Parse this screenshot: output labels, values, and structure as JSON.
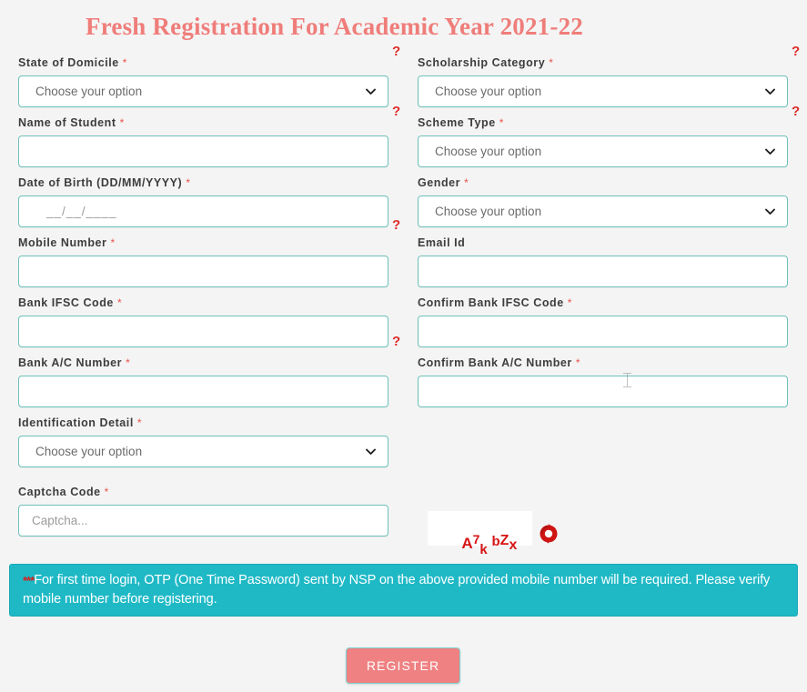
{
  "page": {
    "title": "Fresh Registration For Academic Year 2021-22",
    "background_color": "#f4f4f4",
    "title_color": "#ef7d7a",
    "accent_border_color": "#6cc1b9",
    "required_marker": "*",
    "help_marker": "?"
  },
  "form": {
    "left_column": [
      {
        "label": "State of Domicile",
        "required": true,
        "type": "select",
        "value": "Choose your option",
        "has_help": true
      },
      {
        "label": "Name of Student",
        "required": true,
        "type": "text",
        "value": "",
        "placeholder": "",
        "has_help": false
      },
      {
        "label": "Date of Birth (DD/MM/YYYY)",
        "required": true,
        "type": "text",
        "value": "",
        "placeholder": "__/__/____",
        "has_help": true
      },
      {
        "label": "Mobile Number",
        "required": true,
        "type": "text",
        "value": "",
        "placeholder": "",
        "has_help": false
      },
      {
        "label": "Bank IFSC Code",
        "required": true,
        "type": "text",
        "value": "",
        "placeholder": "",
        "has_help": true
      },
      {
        "label": "Bank A/C Number",
        "required": true,
        "type": "text",
        "value": "",
        "placeholder": "",
        "has_help": false
      },
      {
        "label": "Identification Detail",
        "required": true,
        "type": "select",
        "value": "Choose your option",
        "has_help": false
      }
    ],
    "right_column": [
      {
        "label": "Scholarship Category",
        "required": true,
        "type": "select",
        "value": "Choose your option",
        "has_help": true
      },
      {
        "label": "Scheme Type",
        "required": true,
        "type": "select",
        "value": "Choose your option",
        "has_help": false
      },
      {
        "label": "Gender",
        "required": true,
        "type": "select",
        "value": "Choose your option",
        "has_help": false
      },
      {
        "label": "Email Id",
        "required": false,
        "type": "text",
        "value": "",
        "placeholder": "",
        "has_help": false
      },
      {
        "label": "Confirm Bank IFSC Code",
        "required": true,
        "type": "text",
        "value": "",
        "placeholder": "",
        "has_help": false
      },
      {
        "label": "Confirm Bank A/C Number",
        "required": true,
        "type": "text",
        "value": "",
        "placeholder": "",
        "has_help": false
      }
    ],
    "captcha": {
      "label": "Captcha Code",
      "required": true,
      "placeholder": "Captcha...",
      "value": "",
      "image_text": "A7k bZx",
      "image_chars": [
        "A",
        "7",
        "k",
        " ",
        "b",
        "Z",
        "x"
      ],
      "image_text_color": "#d61414",
      "refresh_icon": "refresh-icon"
    }
  },
  "banner": {
    "stars": "***",
    "text": "For first time login, OTP (One Time Password) sent by NSP on the above provided mobile number will be required. Please verify mobile number before registering.",
    "background_color": "#1fb9c6",
    "text_color": "#ffffff",
    "stars_color": "#d02020"
  },
  "actions": {
    "register_label": "REGISTER",
    "register_color": "#ef8182"
  }
}
